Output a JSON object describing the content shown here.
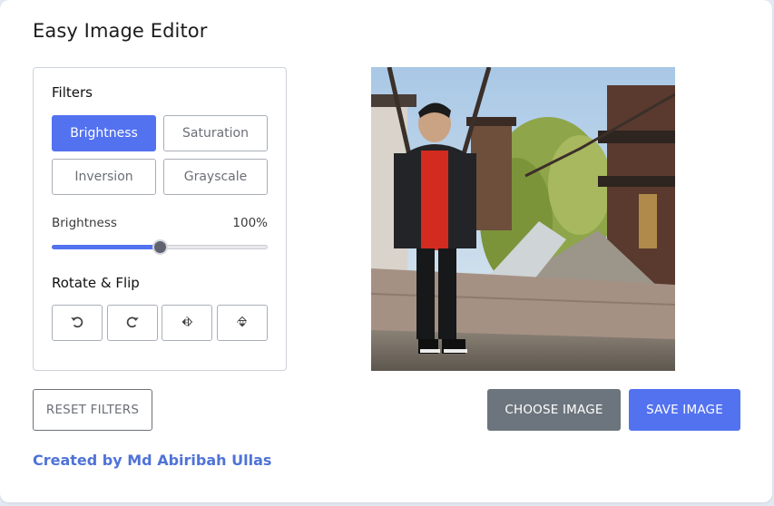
{
  "app": {
    "title": "Easy Image Editor"
  },
  "filters": {
    "label": "Filters",
    "buttons": [
      {
        "label": "Brightness",
        "active": true
      },
      {
        "label": "Saturation",
        "active": false
      },
      {
        "label": "Inversion",
        "active": false
      },
      {
        "label": "Grayscale",
        "active": false
      }
    ],
    "slider": {
      "name": "Brightness",
      "value": "100%",
      "fraction": 0.5
    }
  },
  "rotate": {
    "label": "Rotate & Flip",
    "buttons": [
      "rotate-left-icon",
      "rotate-right-icon",
      "flip-horizontal-icon",
      "flip-vertical-icon"
    ]
  },
  "actions": {
    "reset": "RESET FILTERS",
    "choose": "CHOOSE IMAGE",
    "save": "SAVE IMAGE"
  },
  "footer": {
    "credit": "Created by Md Abiribah Ullas"
  },
  "colors": {
    "accent": "#5372f0",
    "secondary": "#6c757d",
    "credit": "#4f73d6"
  }
}
